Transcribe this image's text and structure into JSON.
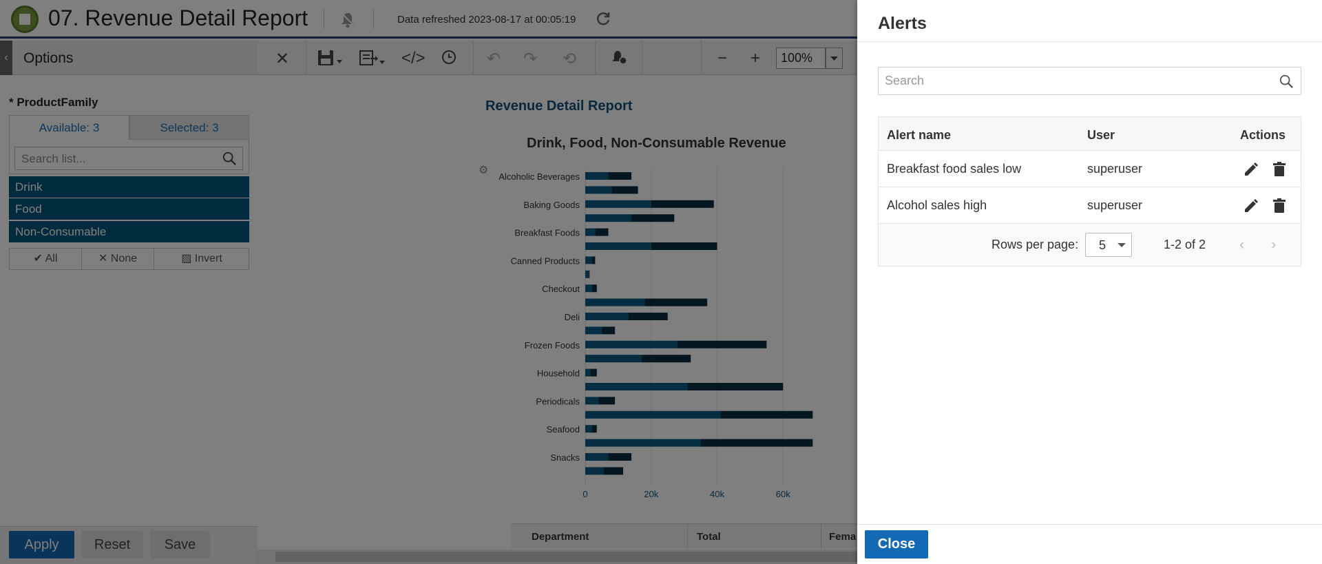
{
  "header": {
    "title": "07. Revenue Detail Report",
    "refresh_text": "Data refreshed 2023-08-17 at 00:05:19",
    "icons": {
      "logo": "app-logo",
      "bell": "bell-off-icon",
      "refresh": "refresh-icon"
    }
  },
  "options": {
    "title": "Options",
    "filter_label": "* ProductFamily",
    "tab_available": "Available: 3",
    "tab_selected": "Selected: 3",
    "search_placeholder": "Search list...",
    "items": [
      "Drink",
      "Food",
      "Non-Consumable"
    ],
    "btn_all": "All",
    "btn_none": "None",
    "btn_invert": "Invert",
    "apply": "Apply",
    "reset": "Reset",
    "save": "Save"
  },
  "toolbar": {
    "zoom": "100%"
  },
  "report": {
    "title": "Revenue Detail Report",
    "table_headers": [
      "Department",
      "Total",
      "Fema"
    ]
  },
  "chart_data": {
    "type": "bar",
    "orientation": "horizontal",
    "stacked": true,
    "title": "Drink, Food, Non-Consumable Revenue",
    "category_labels": [
      "Alcoholic Beverages",
      "Baking Goods",
      "Breakfast Foods",
      "Canned Products",
      "Checkout",
      "Deli",
      "Frozen Foods",
      "Household",
      "Periodicals",
      "Seafood",
      "Snacks"
    ],
    "x_ticks": [
      "0",
      "20k",
      "40k",
      "60k"
    ],
    "xlim": [
      0,
      69000
    ],
    "colors": [
      "#0d5c86",
      "#082c3e"
    ],
    "bars": [
      [
        7000,
        7000
      ],
      [
        8000,
        8000
      ],
      [
        20000,
        19000
      ],
      [
        14000,
        13000
      ],
      [
        3000,
        4000
      ],
      [
        20000,
        20000
      ],
      [
        2000,
        1000
      ],
      [
        1000,
        300
      ],
      [
        2000,
        1500
      ],
      [
        18000,
        19000
      ],
      [
        13000,
        12000
      ],
      [
        5000,
        4000
      ],
      [
        28000,
        27000
      ],
      [
        17000,
        15000
      ],
      [
        1500,
        2000
      ],
      [
        31000,
        29000
      ],
      [
        4000,
        5000
      ],
      [
        41000,
        28000
      ],
      [
        2000,
        1500
      ],
      [
        35000,
        34000
      ],
      [
        7000,
        7000
      ],
      [
        5500,
        6000
      ]
    ]
  },
  "alerts": {
    "title": "Alerts",
    "search_placeholder": "Search",
    "columns": [
      "Alert name",
      "User",
      "Actions"
    ],
    "rows": [
      {
        "name": "Breakfast food sales low",
        "user": "superuser"
      },
      {
        "name": "Alcohol sales high",
        "user": "superuser"
      }
    ],
    "rows_per_page_label": "Rows per page:",
    "rows_per_page": "5",
    "page_info": "1-2 of 2",
    "close": "Close"
  }
}
